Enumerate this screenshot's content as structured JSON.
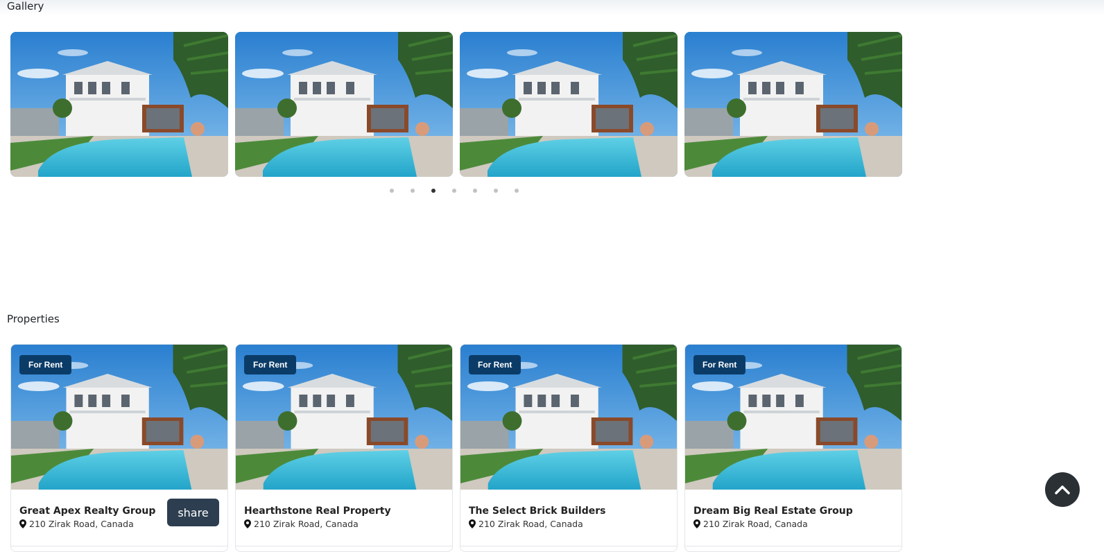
{
  "gallery": {
    "title": "Gallery",
    "image_count": 4,
    "dots_count": 7,
    "active_dot": 3
  },
  "properties": {
    "title": "Properties",
    "items": [
      {
        "badge": "For Rent",
        "name": "Great Apex Realty Group",
        "address": "210 Zirak Road, Canada",
        "share_label": "share"
      },
      {
        "badge": "For Rent",
        "name": "Hearthstone Real Property",
        "address": "210 Zirak Road, Canada"
      },
      {
        "badge": "For Rent",
        "name": "The Select Brick Builders",
        "address": "210 Zirak Road, Canada"
      },
      {
        "badge": "For Rent",
        "name": "Dream Big Real Estate Group",
        "address": "210 Zirak Road, Canada"
      }
    ]
  },
  "colors": {
    "badge_bg": "#0b3c68",
    "share_bg": "#2c3e50",
    "scroll_top_bg": "#2b3035",
    "active_dot": "#333333",
    "inactive_dot": "#c2c2c2"
  },
  "icons": {
    "location": "map-pin-icon",
    "scroll_top": "chevron-up-icon"
  }
}
